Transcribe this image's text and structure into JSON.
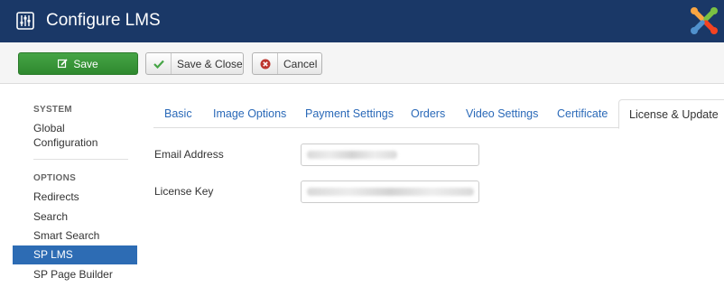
{
  "header": {
    "title": "Configure LMS",
    "bg_color": "#1a3867",
    "app_icon": "sliders-icon",
    "logo": "joomla-logo"
  },
  "toolbar": {
    "save_label": "Save",
    "save_close_label": "Save & Close",
    "cancel_label": "Cancel",
    "save_color": "#3c9c3c"
  },
  "sidebar": {
    "system_header": "SYSTEM",
    "global_config_line1": "Global",
    "global_config_line2": "Configuration",
    "options_header": "OPTIONS",
    "items": [
      "Redirects",
      "Search",
      "Smart Search",
      "SP LMS",
      "SP Page Builder"
    ],
    "active_item": "SP LMS",
    "active_color": "#2d6cb4"
  },
  "tabs": {
    "items": [
      "Basic",
      "Image Options",
      "Payment Settings",
      "Orders",
      "Video Settings",
      "Certificate",
      "License & Update"
    ],
    "active": "License & Update"
  },
  "form": {
    "email_label": "Email Address",
    "email_value": "",
    "license_label": "License Key",
    "license_value": ""
  }
}
